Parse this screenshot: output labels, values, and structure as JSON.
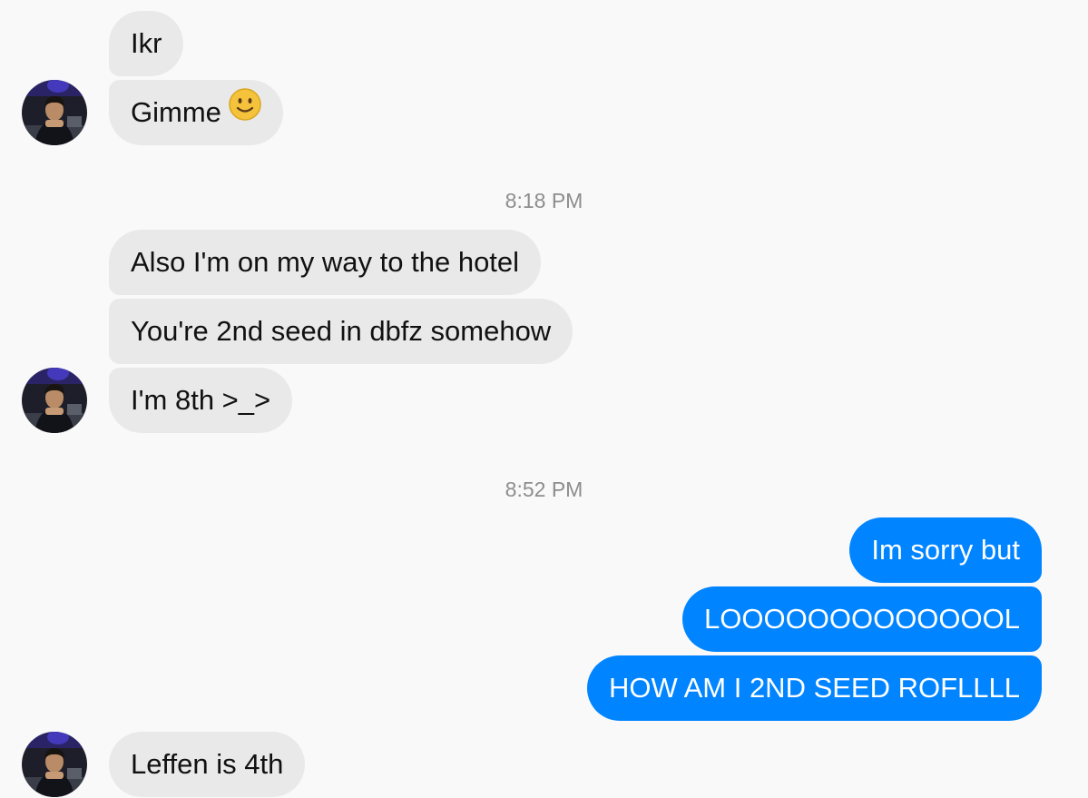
{
  "messages": {
    "m1": "Ikr",
    "m2": "Gimme",
    "m3": "Also I'm on my way to the hotel",
    "m4": "You're 2nd seed in dbfz somehow",
    "m5": "I'm 8th >_>",
    "m6": "Im sorry but",
    "m7": "LOOOOOOOOOOOOOL",
    "m8": "HOW AM I 2ND SEED ROFLLLL",
    "m9": "Leffen is 4th"
  },
  "timestamps": {
    "t1": "8:18 PM",
    "t2": "8:52 PM"
  },
  "icons": {
    "emoji": "slightly-smiling-face-icon",
    "avatar": "contact-avatar-photo"
  },
  "colors": {
    "background": "#f9f9f9",
    "incoming_bubble": "#e9e9e9",
    "outgoing_bubble": "#0084ff",
    "timestamp_text": "#8d8d8d"
  }
}
